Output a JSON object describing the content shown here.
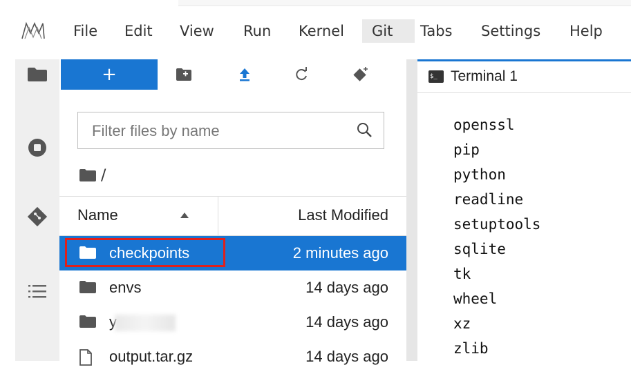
{
  "menubar": {
    "items": [
      {
        "label": "File"
      },
      {
        "label": "Edit"
      },
      {
        "label": "View"
      },
      {
        "label": "Run"
      },
      {
        "label": "Kernel"
      },
      {
        "label": "Git"
      },
      {
        "label": "Tabs"
      },
      {
        "label": "Settings"
      },
      {
        "label": "Help"
      }
    ]
  },
  "rail": {
    "icons": [
      "folder-icon",
      "running-icon",
      "git-icon",
      "table-of-contents-icon"
    ]
  },
  "toolbar": {
    "new_label": "+",
    "icons": [
      "new-folder-icon",
      "upload-icon",
      "refresh-icon",
      "git-clone-icon"
    ]
  },
  "filebrowser": {
    "filter_placeholder": "Filter files by name",
    "breadcrumb": "/",
    "columns": {
      "name": "Name",
      "modified": "Last Modified"
    },
    "rows": [
      {
        "name": "checkpoints",
        "modified": "2 minutes ago",
        "type": "folder",
        "selected": true
      },
      {
        "name": "envs",
        "modified": "14 days ago",
        "type": "folder",
        "selected": false
      },
      {
        "name": "y",
        "modified": "14 days ago",
        "type": "folder",
        "selected": false
      },
      {
        "name": "output.tar.gz",
        "modified": "14 days ago",
        "type": "file",
        "selected": false
      }
    ]
  },
  "terminal": {
    "tab_label": "Terminal 1",
    "tab_icon_text": "$_",
    "lines": [
      "openssl",
      "pip",
      "python",
      "readline",
      "setuptools",
      "sqlite",
      "tk",
      "wheel",
      "xz",
      "zlib"
    ]
  },
  "colors": {
    "accent": "#1976d2",
    "highlight": "#e0201c"
  }
}
